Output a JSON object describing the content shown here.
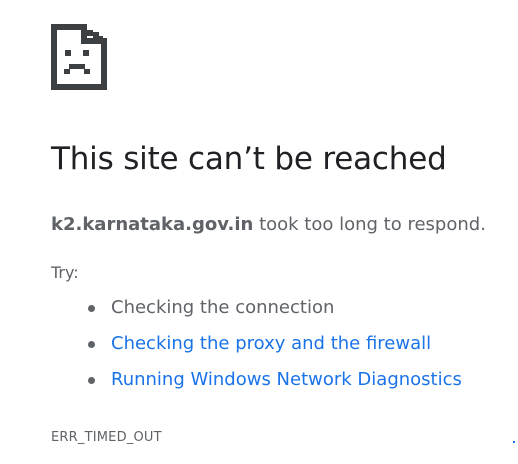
{
  "error_icon": "sad-page-icon",
  "title": "This site can’t be reached",
  "message": {
    "host": "k2.karnataka.gov.in",
    "text": " took too long to respond."
  },
  "try_label": "Try:",
  "suggestions": [
    {
      "label": "Checking the connection",
      "is_link": false
    },
    {
      "label": "Checking the proxy and the firewall",
      "is_link": true
    },
    {
      "label": "Running Windows Network Diagnostics",
      "is_link": true
    }
  ],
  "error_code": "ERR_TIMED_OUT",
  "colors": {
    "title": "#202124",
    "text": "#5f6368",
    "link": "#1a73e8",
    "icon": "#3c4043"
  }
}
